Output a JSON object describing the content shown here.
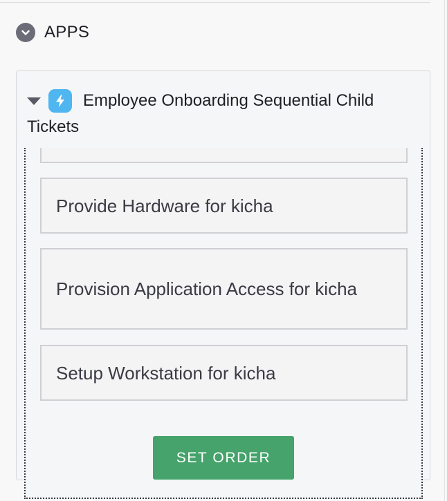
{
  "apps_section": {
    "title": "APPS",
    "toggle_icon": "chevron-down-icon"
  },
  "app": {
    "icon": "lightning-bolt-icon",
    "icon_color": "#4fb6f0",
    "title": "Employee Onboarding Sequential Child Tickets"
  },
  "tickets": [
    {
      "label": ""
    },
    {
      "label": "Provide Hardware for kicha"
    },
    {
      "label": "Provision Application Access for kicha"
    },
    {
      "label": "Setup Workstation for kicha"
    }
  ],
  "actions": {
    "set_order_label": "SET ORDER",
    "set_order_color": "#45a36b"
  }
}
